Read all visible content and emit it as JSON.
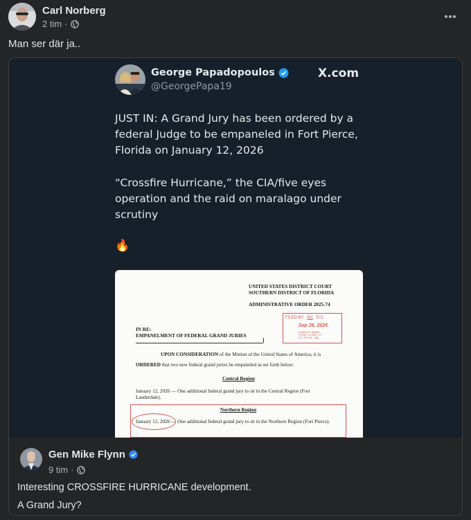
{
  "post": {
    "author": "Carl Norberg",
    "time": "2 tim",
    "separator": "·",
    "text": "Man ser där ja..",
    "more_icon": "ellipsis-icon"
  },
  "tweet": {
    "name": "George Papadopoulos",
    "handle": "@GeorgePapa19",
    "site": "X.com",
    "paragraph1": [
      "JUST IN: A Grand Jury has been ordered by a",
      "federal Judge to be empaneled in Fort Pierce,",
      "Florida on January 12, 2026"
    ],
    "paragraph2": [
      "“Crossfire Hurricane,” the CIA/five eyes",
      "operation and the raid on maralago under",
      "scrutiny"
    ],
    "emoji": "🔥",
    "colors": {
      "background": "#15202b",
      "verified": "#1d9bf0"
    }
  },
  "document": {
    "court_line1": "UNITED STATES DISTRICT COURT",
    "court_line2": "SOUTHERN DISTRICT OF FLORIDA",
    "order": "ADMINISTRATIVE ORDER 2025-74",
    "stamp": {
      "filed": "FILED BY",
      "initials": "NC",
      "dc": "D.C.",
      "date": "Sep 26, 2025",
      "clerk1": "ANGELA E. NOBLE",
      "clerk2": "CLERK U.S. DIST. CT.",
      "clerk3": "S.D. OF FLA. - MIA"
    },
    "in_re": "IN RE:",
    "subject": "EMPANELMENT OF FEDERAL GRAND JURIES",
    "upon_bold": "UPON CONSIDERATION",
    "upon_rest": "of the Motion of the United States of America, it is",
    "ordered_bold": "ORDERED",
    "ordered_rest": "that two new federal grand juries be empaneled as set forth below:",
    "central_heading": "Central Region",
    "central_line1": "January 12, 2026 — One additional federal grand jury to sit in the Central Region (Fort",
    "central_line2": "Lauderdale).",
    "northern_heading": "Northern Region",
    "northern_date": "January 12, 2026",
    "northern_rest": "— One additional federal grand jury to sit in the Northern Region (Fort Pierce)."
  },
  "shared_post": {
    "author": "Gen Mike Flynn",
    "time": "9 tim",
    "separator": "·",
    "line1": "Interesting CROSSFIRE HURRICANE development.",
    "line2": "A Grand Jury?",
    "colors": {
      "verified": "#2d88ff"
    }
  }
}
